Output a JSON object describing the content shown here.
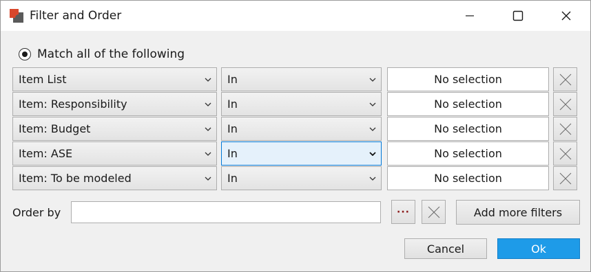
{
  "window": {
    "title": "Filter and Order"
  },
  "match": {
    "label": "Match all of the following",
    "selected": true
  },
  "filters": [
    {
      "field": "Item List",
      "operator": "In",
      "value": "No selection"
    },
    {
      "field": "Item: Responsibility",
      "operator": "In",
      "value": "No selection"
    },
    {
      "field": "Item: Budget",
      "operator": "In",
      "value": "No selection"
    },
    {
      "field": "Item: ASE",
      "operator": "In",
      "value": "No selection",
      "focused": true
    },
    {
      "field": "Item: To be modeled",
      "operator": "In",
      "value": "No selection"
    }
  ],
  "order": {
    "label": "Order by",
    "value": "",
    "more_label": "···"
  },
  "buttons": {
    "add_more": "Add more filters",
    "cancel": "Cancel",
    "ok": "Ok"
  },
  "colors": {
    "accent": "#1e9be8",
    "app_icon_red": "#d9472b",
    "app_icon_dark": "#5a5a5a",
    "dots": "#8b1a1a"
  },
  "icons": {
    "app": "app-icon",
    "minimize": "minimize-icon",
    "maximize": "maximize-icon",
    "close": "close-icon",
    "dropdown": "chevron-down-icon",
    "remove": "remove-icon"
  }
}
